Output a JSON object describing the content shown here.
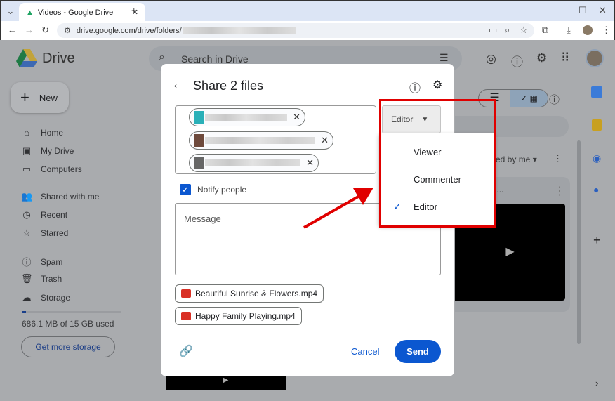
{
  "browser": {
    "tab_title": "Videos - Google Drive",
    "url": "drive.google.com/drive/folders/"
  },
  "app": {
    "name": "Drive",
    "search_placeholder": "Search in Drive"
  },
  "sidebar": {
    "new_label": "New",
    "items": [
      {
        "label": "Home",
        "icon": "home-icon"
      },
      {
        "label": "My Drive",
        "icon": "my-drive-icon"
      },
      {
        "label": "Computers",
        "icon": "computers-icon"
      },
      {
        "label": "Shared with me",
        "icon": "shared-icon"
      },
      {
        "label": "Recent",
        "icon": "clock-icon"
      },
      {
        "label": "Starred",
        "icon": "star-icon"
      },
      {
        "label": "Spam",
        "icon": "spam-icon"
      },
      {
        "label": "Trash",
        "icon": "trash-icon"
      },
      {
        "label": "Storage",
        "icon": "cloud-icon"
      }
    ],
    "storage_text": "686.1 MB of 15 GB used",
    "storage_fraction": 0.045,
    "get_storage": "Get more storage"
  },
  "main": {
    "sort_label": "ed by me",
    "card_title": "ful Nature...."
  },
  "dialog": {
    "title": "Share 2 files",
    "role_button": "Editor",
    "notify_label": "Notify people",
    "notify_checked": true,
    "message_placeholder": "Message",
    "files": [
      "Beautiful Sunrise & Flowers.mp4",
      "Happy Family Playing.mp4"
    ],
    "cancel": "Cancel",
    "send": "Send",
    "role_options": [
      {
        "label": "Viewer",
        "selected": false
      },
      {
        "label": "Commenter",
        "selected": false
      },
      {
        "label": "Editor",
        "selected": true
      }
    ]
  },
  "colors": {
    "accent": "#0b57d0",
    "annotation": "#e00000"
  }
}
